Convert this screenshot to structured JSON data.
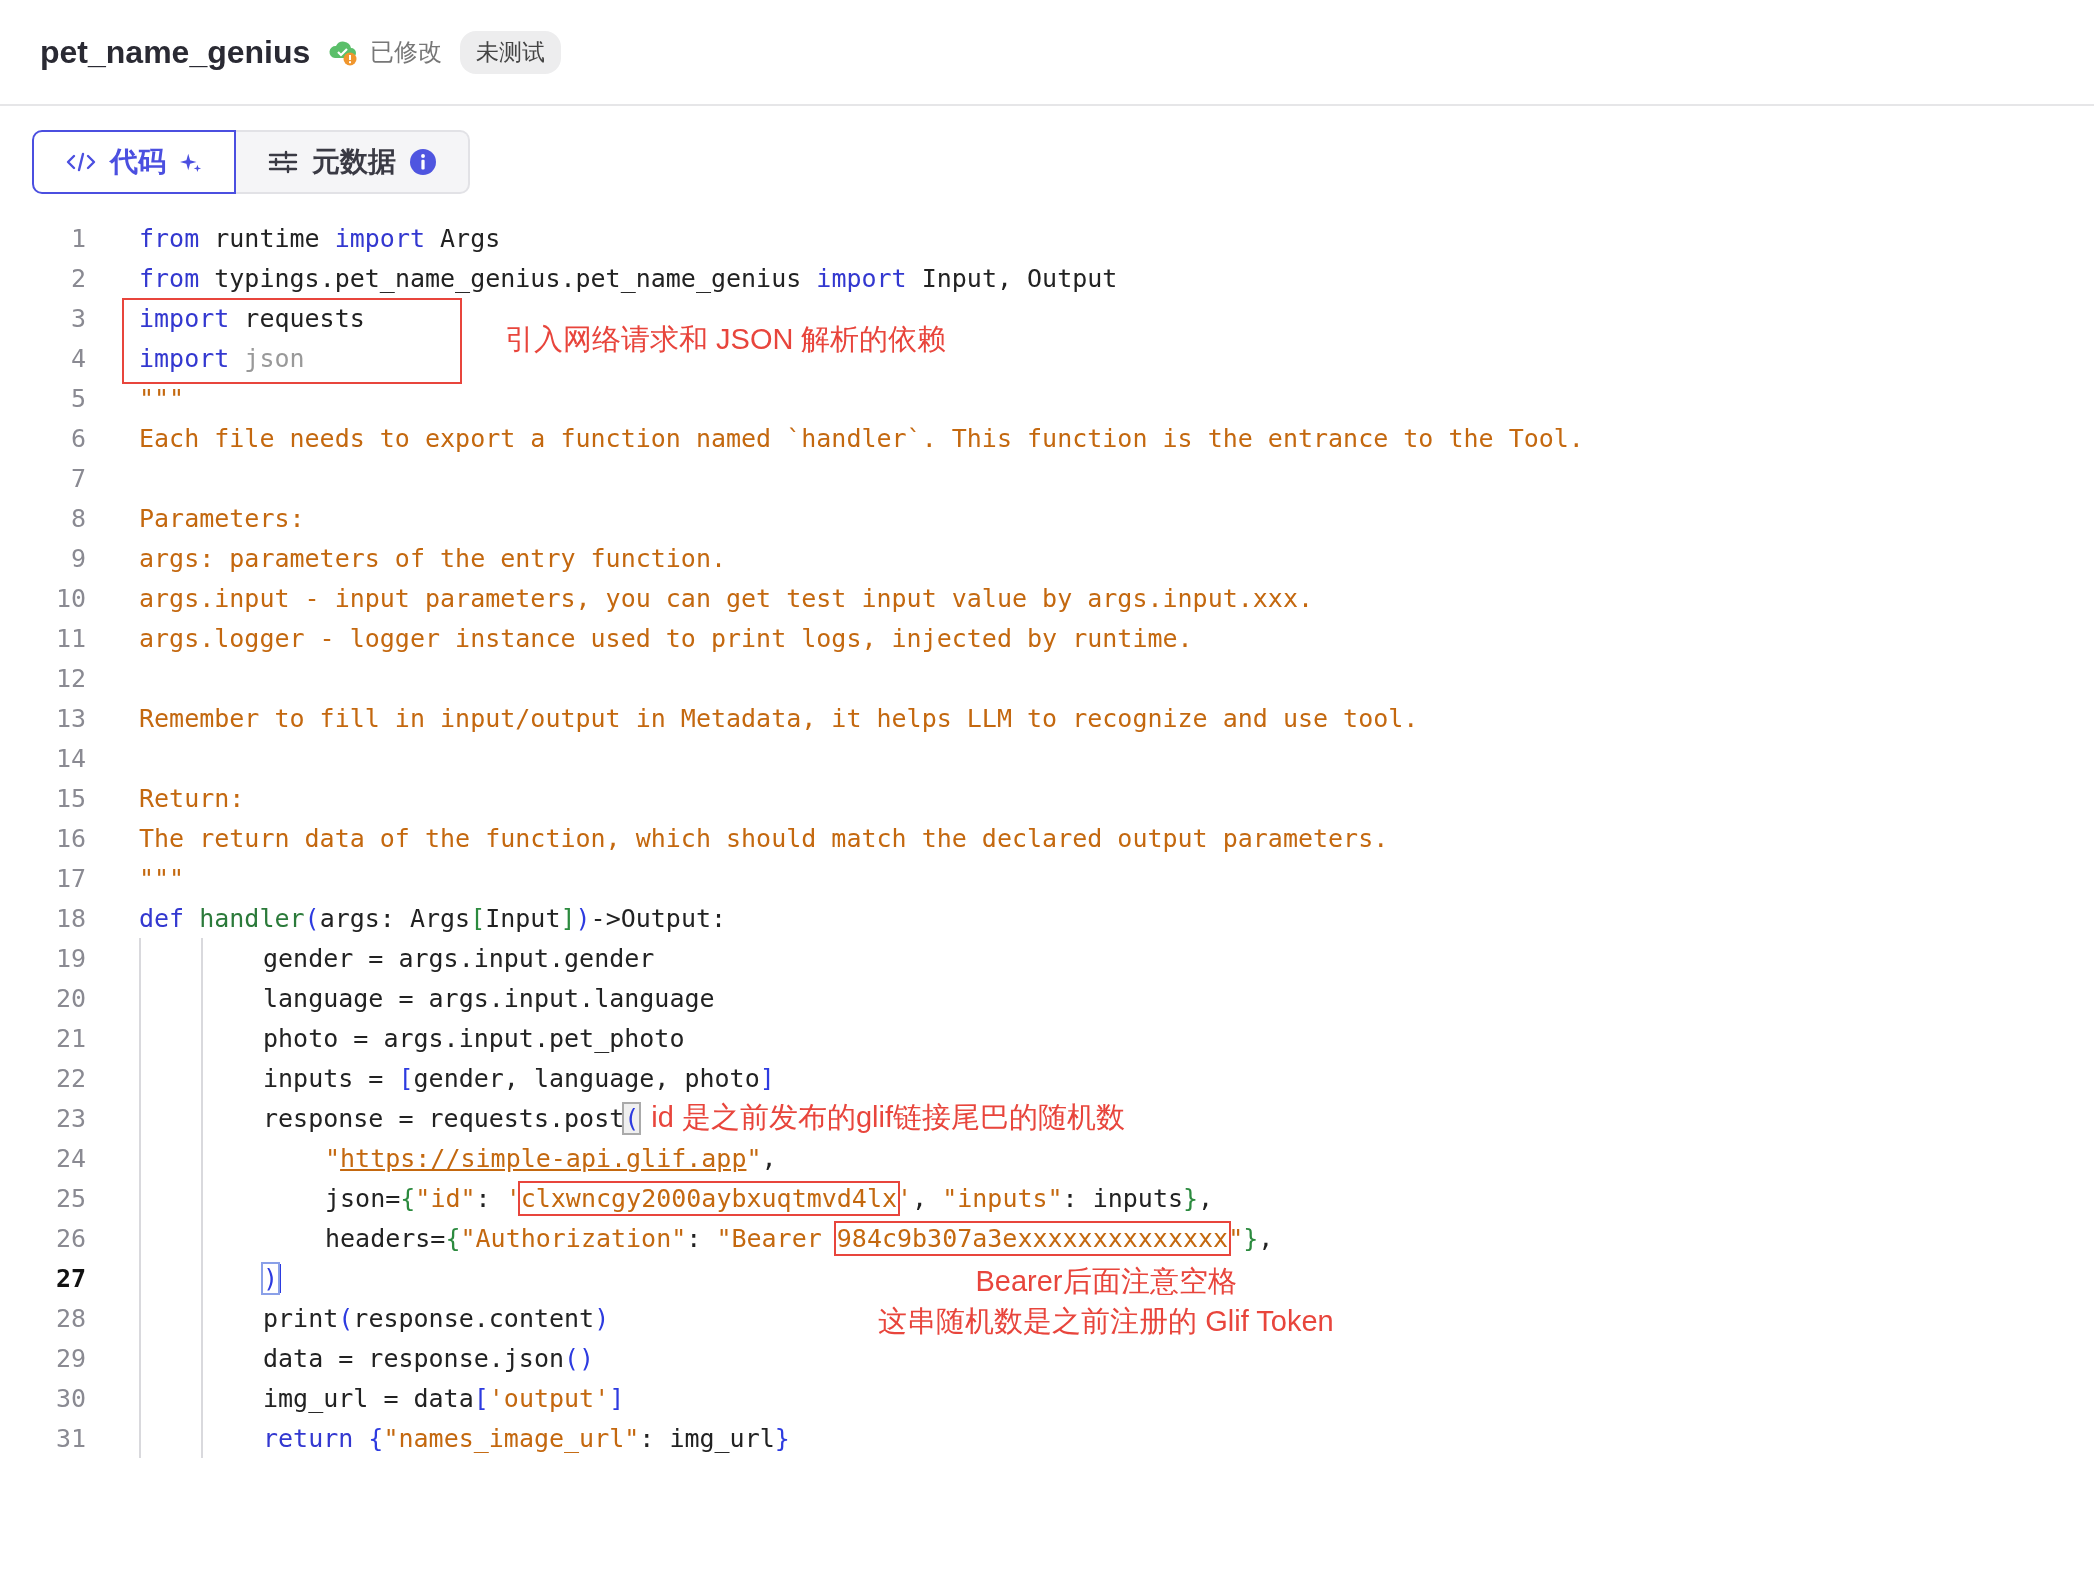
{
  "header": {
    "title": "pet_name_genius",
    "status": "已修改",
    "badge": "未测试"
  },
  "tabs": [
    {
      "kind": "code",
      "label": "代码",
      "selected": true
    },
    {
      "kind": "metadata",
      "label": "元数据",
      "selected": false
    }
  ],
  "code": {
    "lines": [
      {
        "number": "1",
        "tokens": [
          {
            "kind": "kw",
            "text": "from"
          },
          {
            "kind": "plain",
            "text": " runtime "
          },
          {
            "kind": "kw",
            "text": "import"
          },
          {
            "kind": "plain",
            "text": " Args"
          }
        ]
      },
      {
        "number": "2",
        "tokens": [
          {
            "kind": "kw",
            "text": "from"
          },
          {
            "kind": "plain",
            "text": " typings.pet_name_genius.pet_name_genius "
          },
          {
            "kind": "kw",
            "text": "import"
          },
          {
            "kind": "plain",
            "text": " Input, Output"
          }
        ]
      },
      {
        "number": "3",
        "frame": true,
        "tokens": [
          {
            "kind": "kw",
            "text": "import"
          },
          {
            "kind": "plain",
            "text": " requests"
          }
        ],
        "note": {
          "kind": "aside",
          "text": "引入网络请求和 JSON 解析的依赖"
        }
      },
      {
        "number": "4",
        "tokens": [
          {
            "kind": "kw",
            "text": "import"
          },
          {
            "kind": "muted",
            "text": " json"
          }
        ]
      },
      {
        "number": "5",
        "tokens": [
          {
            "kind": "str",
            "text": "\"\"\""
          }
        ]
      },
      {
        "number": "6",
        "tokens": [
          {
            "kind": "str",
            "text": "Each file needs to export a function named `handler`. This function is the entrance to the Tool."
          }
        ]
      },
      {
        "number": "7"
      },
      {
        "number": "8",
        "tokens": [
          {
            "kind": "str",
            "text": "Parameters:"
          }
        ]
      },
      {
        "number": "9",
        "tokens": [
          {
            "kind": "str",
            "text": "args: parameters of the entry function."
          }
        ]
      },
      {
        "number": "10",
        "tokens": [
          {
            "kind": "str",
            "text": "args.input - input parameters, you can get test input value by args.input.xxx."
          }
        ]
      },
      {
        "number": "11",
        "tokens": [
          {
            "kind": "str",
            "text": "args.logger - logger instance used to print logs, injected by runtime."
          }
        ]
      },
      {
        "number": "12"
      },
      {
        "number": "13",
        "tokens": [
          {
            "kind": "str",
            "text": "Remember to fill in input/output in Metadata, it helps LLM to recognize and use tool."
          }
        ]
      },
      {
        "number": "14"
      },
      {
        "number": "15",
        "tokens": [
          {
            "kind": "str",
            "text": "Return:"
          }
        ]
      },
      {
        "number": "16",
        "tokens": [
          {
            "kind": "str",
            "text": "The return data of the function, which should match the declared output parameters."
          }
        ]
      },
      {
        "number": "17",
        "tokens": [
          {
            "kind": "str",
            "text": "\"\"\""
          }
        ]
      },
      {
        "number": "18",
        "tokens": [
          {
            "kind": "kw",
            "text": "def"
          },
          {
            "kind": "fn",
            "text": " handler"
          },
          {
            "kind": "bracket",
            "text": "("
          },
          {
            "kind": "plain",
            "text": "args: Args"
          },
          {
            "kind": "brace",
            "text": "["
          },
          {
            "kind": "plain",
            "text": "Input"
          },
          {
            "kind": "brace",
            "text": "]"
          },
          {
            "kind": "bracket",
            "text": ")"
          },
          {
            "kind": "plain",
            "text": "->Output:"
          }
        ]
      },
      {
        "number": "19",
        "kind": "body",
        "tokens": [
          {
            "kind": "plain",
            "text": "gender = args.input.gender"
          }
        ]
      },
      {
        "number": "20",
        "kind": "body",
        "tokens": [
          {
            "kind": "plain",
            "text": "language = args.input.language"
          }
        ]
      },
      {
        "number": "21",
        "kind": "body",
        "tokens": [
          {
            "kind": "plain",
            "text": "photo = args.input.pet_photo"
          }
        ]
      },
      {
        "number": "22",
        "kind": "body",
        "tokens": [
          {
            "kind": "plain",
            "text": "inputs = "
          },
          {
            "kind": "bracket",
            "text": "["
          },
          {
            "kind": "plain",
            "text": "gender, language, photo"
          },
          {
            "kind": "bracket",
            "text": "]"
          }
        ]
      },
      {
        "number": "23",
        "kind": "body",
        "tokens": [
          {
            "kind": "plain",
            "text": "response = requests.post"
          },
          {
            "kind": "bracket",
            "text": "(",
            "matched": true
          }
        ],
        "note": {
          "kind": "inline",
          "text": "id 是之前发布的glif链接尾巴的随机数"
        }
      },
      {
        "number": "24",
        "kind": "args",
        "tokens": [
          {
            "kind": "str",
            "text": "\""
          },
          {
            "kind": "url",
            "text": "https://simple-api.glif.app"
          },
          {
            "kind": "str",
            "text": "\""
          },
          {
            "kind": "plain",
            "text": ","
          }
        ]
      },
      {
        "number": "25",
        "kind": "args",
        "tokens": [
          {
            "kind": "plain",
            "text": "json="
          },
          {
            "kind": "brace",
            "text": "{"
          },
          {
            "kind": "str",
            "text": "\"id\""
          },
          {
            "kind": "plain",
            "text": ": "
          },
          {
            "kind": "str",
            "text": "'"
          },
          {
            "kind": "str",
            "text": "clxwncgy2000aybxuqtmvd4lx",
            "annotated": true
          },
          {
            "kind": "str",
            "text": "'"
          },
          {
            "kind": "plain",
            "text": ", "
          },
          {
            "kind": "str",
            "text": "\"inputs\""
          },
          {
            "kind": "plain",
            "text": ": inputs"
          },
          {
            "kind": "brace",
            "text": "}"
          },
          {
            "kind": "plain",
            "text": ","
          }
        ]
      },
      {
        "number": "26",
        "kind": "args",
        "tokens": [
          {
            "kind": "plain",
            "text": "headers="
          },
          {
            "kind": "brace",
            "text": "{"
          },
          {
            "kind": "str",
            "text": "\"Authorization\""
          },
          {
            "kind": "plain",
            "text": ": "
          },
          {
            "kind": "str",
            "text": "\"Bearer "
          },
          {
            "kind": "str",
            "text": "984c9b307a3exxxxxxxxxxxxxx",
            "annotated": true
          },
          {
            "kind": "str",
            "text": "\""
          },
          {
            "kind": "brace",
            "text": "}"
          },
          {
            "kind": "plain",
            "text": ","
          }
        ]
      },
      {
        "number": "27",
        "kind": "body",
        "current": true,
        "tokens": [
          {
            "kind": "bracket",
            "text": ")",
            "cursor": true
          }
        ],
        "note": {
          "kind": "centered",
          "text": "Bearer后面注意空格"
        }
      },
      {
        "number": "28",
        "kind": "body",
        "tokens": [
          {
            "kind": "plain",
            "text": "print"
          },
          {
            "kind": "bracket",
            "text": "("
          },
          {
            "kind": "plain",
            "text": "response.content"
          },
          {
            "kind": "bracket",
            "text": ")"
          }
        ],
        "note": {
          "kind": "centered",
          "text": "这串随机数是之前注册的 Glif Token"
        }
      },
      {
        "number": "29",
        "kind": "body",
        "tokens": [
          {
            "kind": "plain",
            "text": "data = response.json"
          },
          {
            "kind": "bracket",
            "text": "()"
          }
        ]
      },
      {
        "number": "30",
        "kind": "body",
        "tokens": [
          {
            "kind": "plain",
            "text": "img_url = data"
          },
          {
            "kind": "bracket",
            "text": "["
          },
          {
            "kind": "str",
            "text": "'output'"
          },
          {
            "kind": "bracket",
            "text": "]"
          }
        ]
      },
      {
        "number": "31",
        "kind": "body",
        "tokens": [
          {
            "kind": "kw",
            "text": "return"
          },
          {
            "kind": "bracket",
            "text": " {"
          },
          {
            "kind": "str",
            "text": "\"names_image_url\""
          },
          {
            "kind": "plain",
            "text": ": img_url"
          },
          {
            "kind": "bracket",
            "text": "}"
          }
        ]
      }
    ]
  }
}
